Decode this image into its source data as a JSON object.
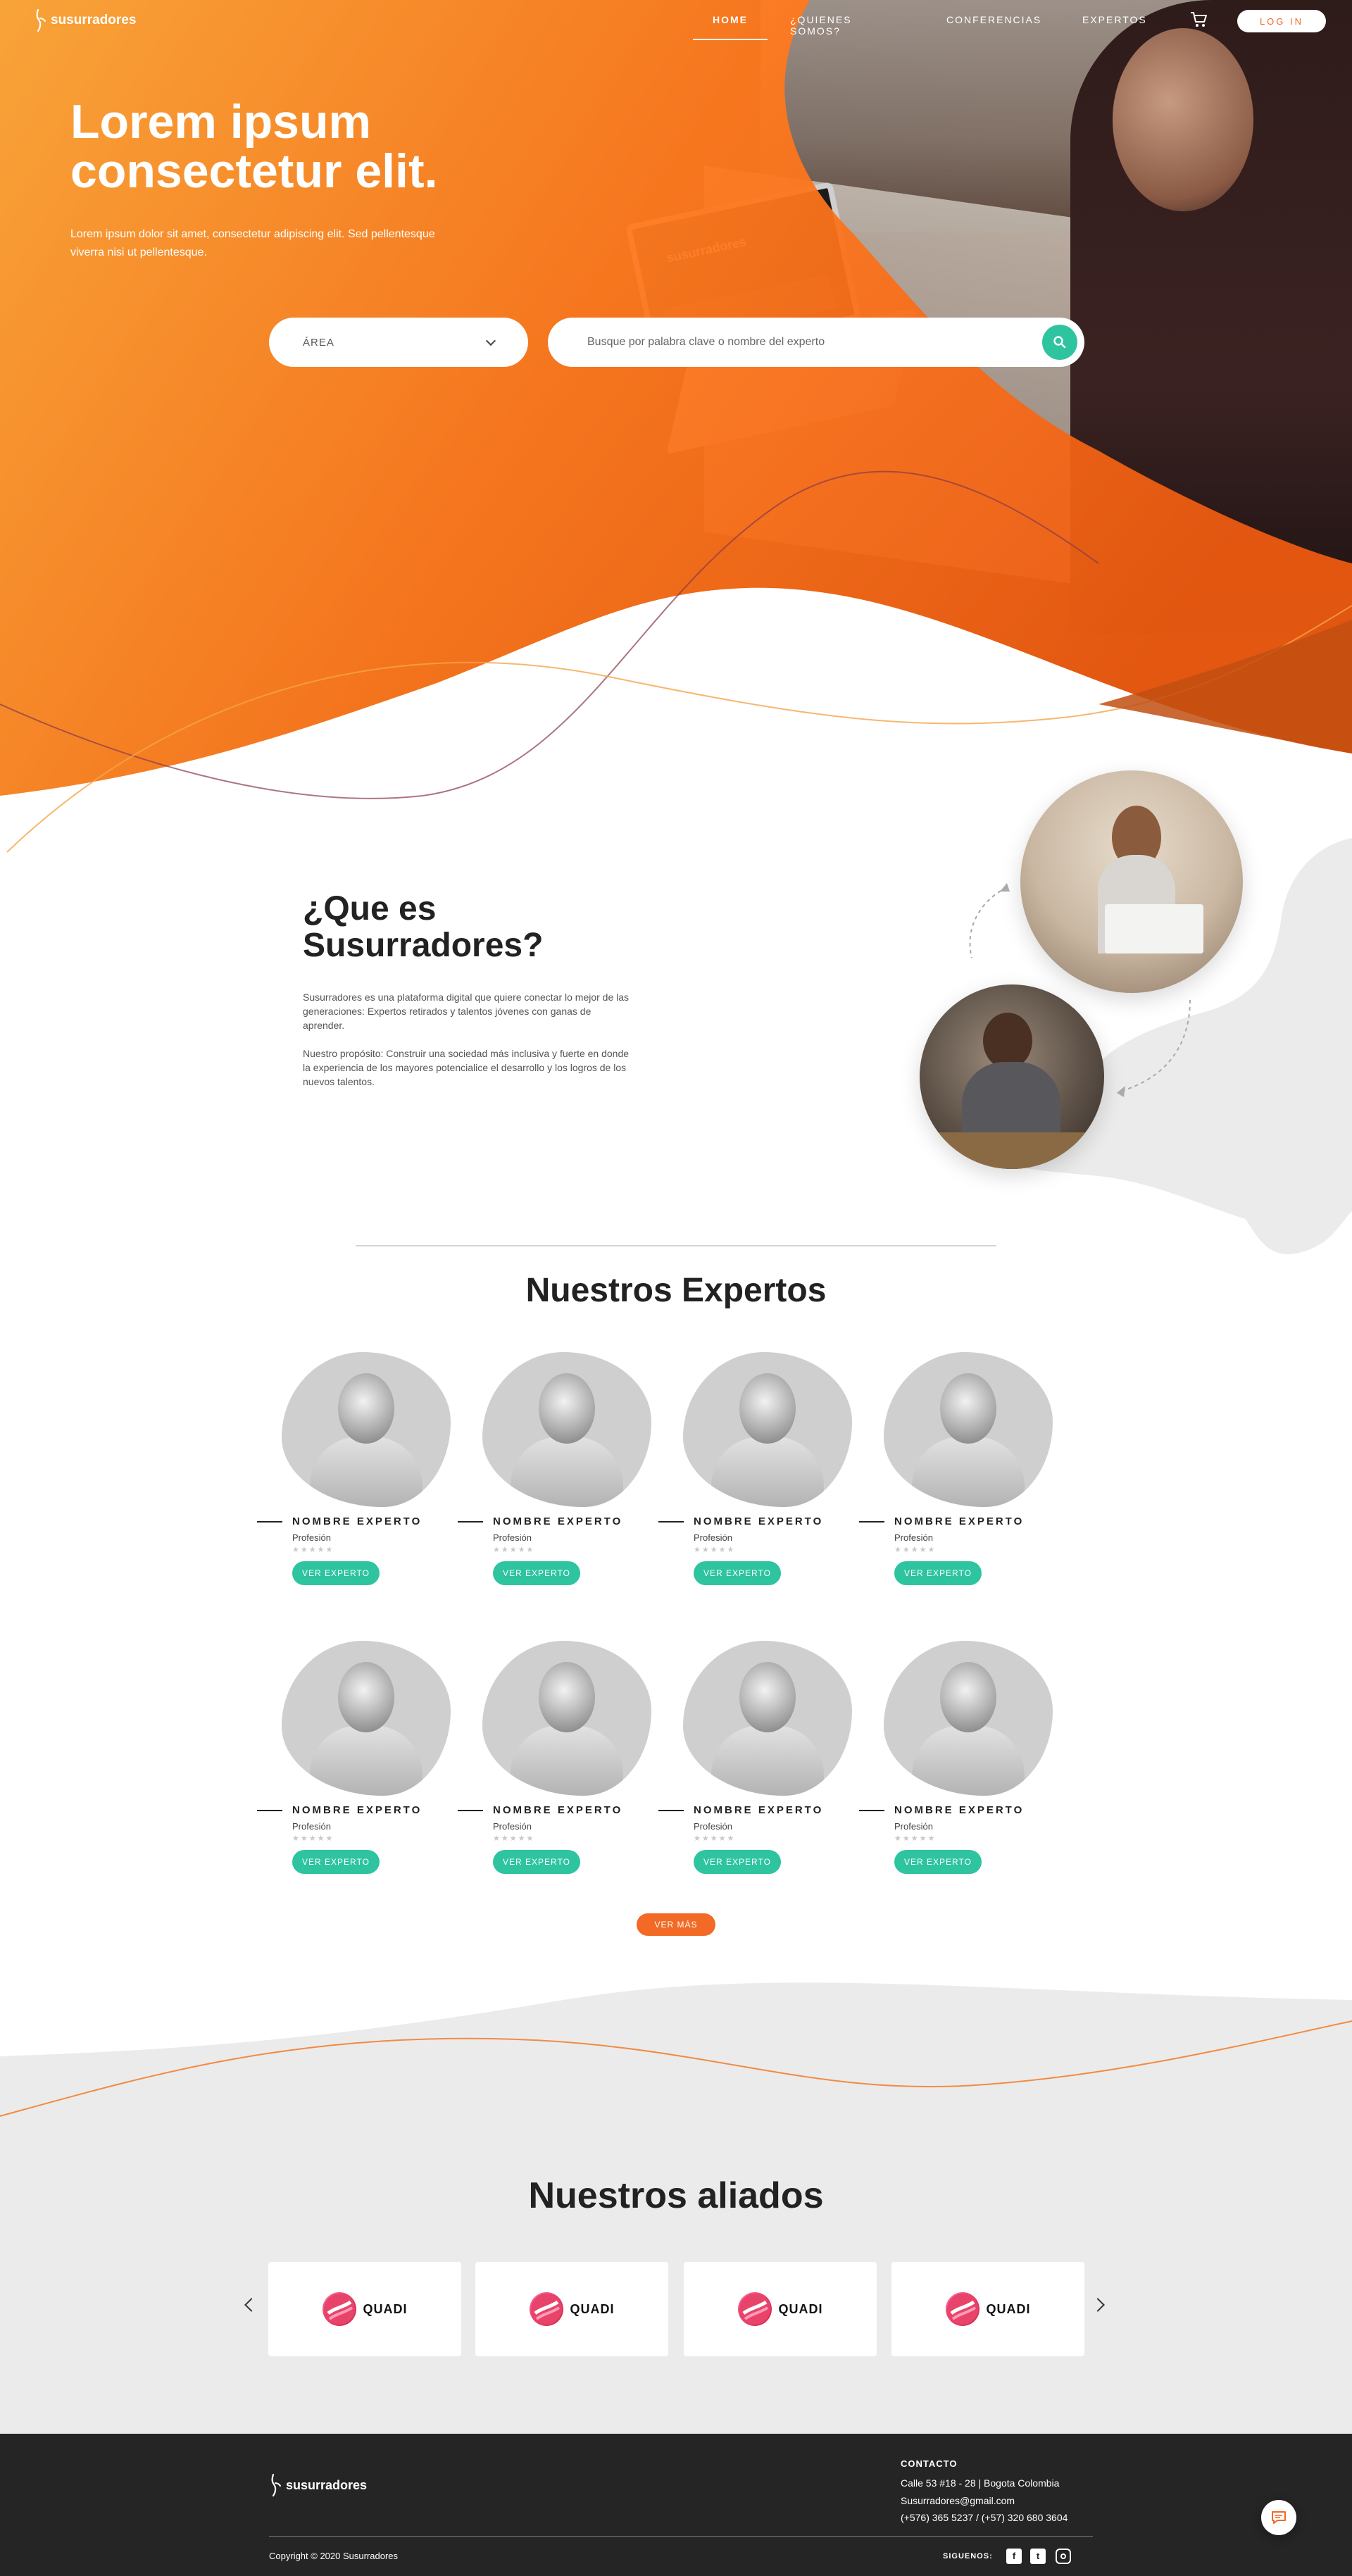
{
  "nav": {
    "logo_text": "susurradores",
    "links": [
      "HOME",
      "¿QUIENES SOMOS?",
      "CONFERENCIAS",
      "EXPERTOS"
    ],
    "login_label": "LOG IN"
  },
  "hero": {
    "title": "Lorem ipsum consectetur elit.",
    "subtitle": "Lorem ipsum dolor sit amet, consectetur adipiscing elit. Sed pellentesque viverra nisi ut pellentesque.",
    "laptop_brand": "susurradores",
    "area_label": "ÁREA",
    "search_placeholder": "Busque por palabra clave o nombre del experto"
  },
  "about": {
    "title": "¿Que es Susurradores?",
    "paragraph_1": "Susurradores es una plataforma digital que quiere conectar lo mejor de las generaciones: Expertos retirados y talentos jóvenes con ganas de aprender.",
    "paragraph_2": "Nuestro propósito: Construir una sociedad más inclusiva y fuerte en donde la experiencia de los mayores potencialice el desarrollo y los logros de los nuevos talentos."
  },
  "experts": {
    "heading": "Nuestros Expertos",
    "items": [
      {
        "name": "NOMBRE EXPERTO",
        "profession": "Profesión",
        "rating": "★★★★★",
        "button": "VER EXPERTO"
      },
      {
        "name": "NOMBRE EXPERTO",
        "profession": "Profesión",
        "rating": "★★★★★",
        "button": "VER EXPERTO"
      },
      {
        "name": "NOMBRE EXPERTO",
        "profession": "Profesión",
        "rating": "★★★★★",
        "button": "VER EXPERTO"
      },
      {
        "name": "NOMBRE EXPERTO",
        "profession": "Profesión",
        "rating": "★★★★★",
        "button": "VER EXPERTO"
      },
      {
        "name": "NOMBRE EXPERTO",
        "profession": "Profesión",
        "rating": "★★★★★",
        "button": "VER EXPERTO"
      },
      {
        "name": "NOMBRE EXPERTO",
        "profession": "Profesión",
        "rating": "★★★★★",
        "button": "VER EXPERTO"
      },
      {
        "name": "NOMBRE EXPERTO",
        "profession": "Profesión",
        "rating": "★★★★★",
        "button": "VER EXPERTO"
      },
      {
        "name": "NOMBRE EXPERTO",
        "profession": "Profesión",
        "rating": "★★★★★",
        "button": "VER EXPERTO"
      }
    ],
    "more_label": "VER MÁS"
  },
  "allies": {
    "heading": "Nuestros aliados",
    "items": [
      "QUADI",
      "QUADI",
      "QUADI",
      "QUADI"
    ]
  },
  "footer": {
    "logo_text": "susurradores",
    "contact_heading": "CONTACTO",
    "address": "Calle 53 #18 - 28 | Bogota Colombia",
    "email": "Susurradores@gmail.com",
    "phones": "(+576) 365 5237 / (+57) 320 680 3604",
    "copyright": "Copyright © 2020 Susurradores",
    "follow_label": "SIGUENOS:"
  },
  "colors": {
    "brand_orange": "#f26a25",
    "accent_teal": "#2ec4a0",
    "footer_bg": "#252525",
    "light_gray": "#ebebeb"
  },
  "icons": [
    "susurradores-logo-icon",
    "cart-icon",
    "chevron-down-icon",
    "search-icon",
    "chevron-left-icon",
    "chevron-right-icon",
    "facebook-icon",
    "twitter-icon",
    "instagram-icon",
    "chat-icon",
    "quadi-logo-icon"
  ]
}
